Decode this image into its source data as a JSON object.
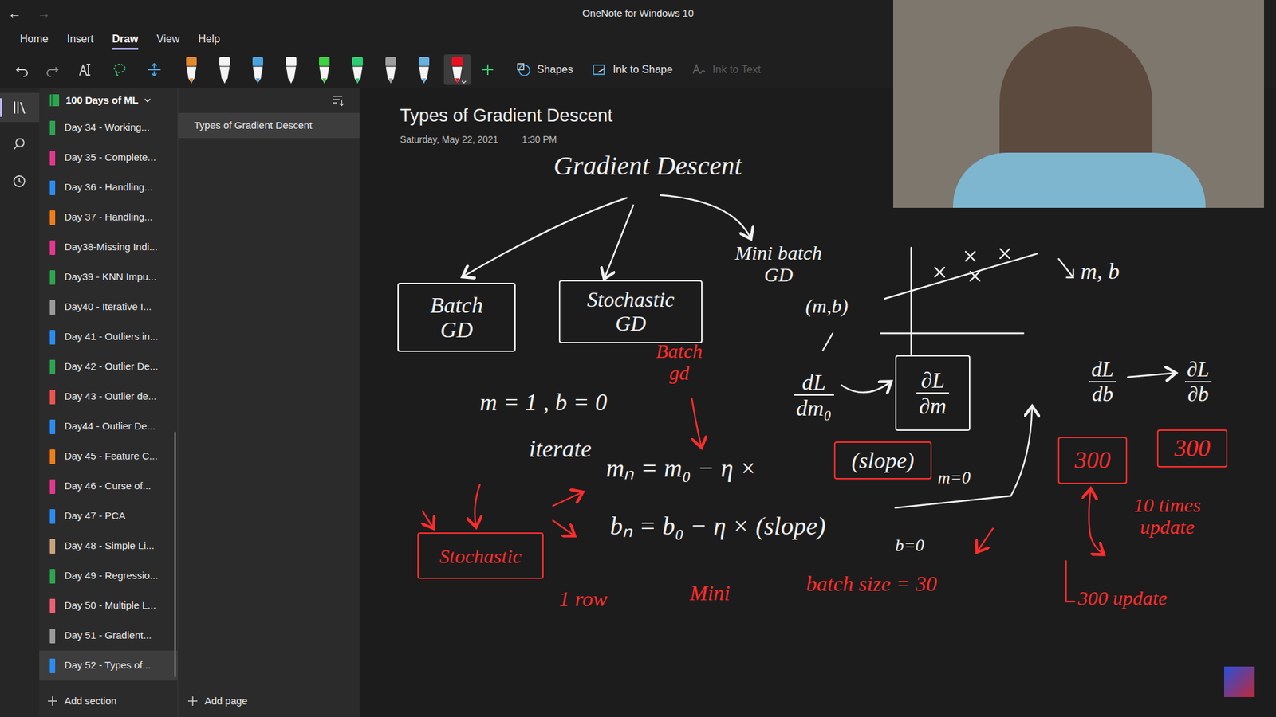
{
  "window": {
    "title": "OneNote for Windows 10"
  },
  "nav": [
    {
      "glyph": "←",
      "disabled": false
    },
    {
      "glyph": "→",
      "disabled": true
    }
  ],
  "menu_tabs": [
    {
      "label": "Home",
      "selected": false
    },
    {
      "label": "Insert",
      "selected": false
    },
    {
      "label": "Draw",
      "selected": true
    },
    {
      "label": "View",
      "selected": false
    },
    {
      "label": "Help",
      "selected": false
    }
  ],
  "toolbar": {
    "pens": [
      {
        "color": "#e08a2c",
        "selected": false
      },
      {
        "color": "#f4f4f4",
        "selected": false
      },
      {
        "color": "#4aa3df",
        "selected": false
      },
      {
        "color": "#f4f4f4",
        "selected": false
      },
      {
        "color": "#3fd13f",
        "selected": false
      },
      {
        "color": "#2ecc71",
        "selected": false
      },
      {
        "color": "#9e9e9e",
        "selected": false
      },
      {
        "color": "#6ab0de",
        "selected": false
      },
      {
        "color": "#e81123",
        "selected": true
      }
    ],
    "shapes": "Shapes",
    "ink_to_shape": "Ink to Shape",
    "ink_to_text": {
      "label": "Ink to Text",
      "disabled": true
    }
  },
  "rail": [
    {
      "selected": true
    },
    {
      "selected": false
    },
    {
      "selected": false
    }
  ],
  "notebook": {
    "name": "100 Days of ML"
  },
  "sections": [
    {
      "label": "Day 34 - Working...",
      "color": "#2ea44f",
      "selected": false
    },
    {
      "label": "Day 35 - Complete...",
      "color": "#e3368f",
      "selected": false
    },
    {
      "label": "Day 36 - Handling...",
      "color": "#2a8bf2",
      "selected": false
    },
    {
      "label": "Day 37 - Handling...",
      "color": "#f07c1a",
      "selected": false
    },
    {
      "label": "Day38-Missing Indi...",
      "color": "#e3368f",
      "selected": false
    },
    {
      "label": "Day39 - KNN Impu...",
      "color": "#2ea44f",
      "selected": false
    },
    {
      "label": "Day40 - Iterative I...",
      "color": "#9a9a9a",
      "selected": false
    },
    {
      "label": "Day 41 - Outliers in...",
      "color": "#2a8bf2",
      "selected": false
    },
    {
      "label": "Day 42 - Outlier De...",
      "color": "#2ea44f",
      "selected": false
    },
    {
      "label": "Day 43 - Outlier de...",
      "color": "#ef5350",
      "selected": false
    },
    {
      "label": "Day44 - Outlier De...",
      "color": "#2a8bf2",
      "selected": false
    },
    {
      "label": "Day 45 - Feature C...",
      "color": "#f07c1a",
      "selected": false
    },
    {
      "label": "Day 46 - Curse of...",
      "color": "#e3368f",
      "selected": false
    },
    {
      "label": "Day 47 - PCA",
      "color": "#2a8bf2",
      "selected": false
    },
    {
      "label": "Day 48 - Simple Li...",
      "color": "#c8a27a",
      "selected": false
    },
    {
      "label": "Day 49 - Regressio...",
      "color": "#2ea44f",
      "selected": false
    },
    {
      "label": "Day 50 - Multiple L...",
      "color": "#ef5f72",
      "selected": false
    },
    {
      "label": "Day 51 - Gradient...",
      "color": "#9a9a9a",
      "selected": false
    },
    {
      "label": "Day 52 - Types of...",
      "color": "#2a8bf2",
      "selected": true
    }
  ],
  "pages": [
    {
      "label": "Types of Gradient Descent",
      "selected": true
    }
  ],
  "add_section": "Add section",
  "add_page": "Add page",
  "page": {
    "title": "Types of Gradient Descent",
    "date": "Saturday, May 22, 2021",
    "time": "1:30 PM",
    "ink": [
      {
        "kind": "text",
        "lines": [
          "Gradient Descent"
        ],
        "color": "#f2f2f2",
        "boxed": false
      },
      {
        "kind": "text",
        "lines": [
          "Batch",
          "GD"
        ],
        "color": "#f2f2f2",
        "boxed": true,
        "box_color": "#f2f2f2"
      },
      {
        "kind": "text",
        "lines": [
          "Stochastic",
          "GD"
        ],
        "color": "#f2f2f2",
        "boxed": true,
        "box_color": "#f2f2f2"
      },
      {
        "kind": "text",
        "lines": [
          "Mini batch",
          "GD"
        ],
        "color": "#f2f2f2",
        "boxed": false
      },
      {
        "kind": "text",
        "lines": [
          "(m,b)"
        ],
        "color": "#f2f2f2",
        "boxed": false
      },
      {
        "kind": "text",
        "lines": [
          "m, b"
        ],
        "color": "#f2f2f2",
        "boxed": false
      },
      {
        "kind": "fraction",
        "lines": [
          "dL",
          "dm₀"
        ],
        "color": "#f2f2f2",
        "boxed": false
      },
      {
        "kind": "fraction",
        "lines": [
          "∂L",
          "∂m"
        ],
        "color": "#f2f2f2",
        "boxed": true,
        "box_color": "#f2f2f2"
      },
      {
        "kind": "fraction",
        "lines": [
          "dL",
          "db"
        ],
        "color": "#f2f2f2",
        "boxed": false
      },
      {
        "kind": "fraction",
        "lines": [
          "∂L",
          "∂b"
        ],
        "color": "#f2f2f2",
        "boxed": false
      },
      {
        "kind": "text",
        "lines": [
          "m = 1 , b = 0"
        ],
        "color": "#f2f2f2",
        "boxed": false
      },
      {
        "kind": "text",
        "lines": [
          "iterate"
        ],
        "color": "#f2f2f2",
        "boxed": false
      },
      {
        "kind": "text",
        "lines": [
          "mₙ = m₀ − η ×"
        ],
        "color": "#f2f2f2",
        "boxed": false
      },
      {
        "kind": "text",
        "lines": [
          "(slope)"
        ],
        "color": "#f2f2f2",
        "boxed": true,
        "box_color": "#ff2d2d"
      },
      {
        "kind": "text",
        "lines": [
          "m=0"
        ],
        "color": "#f2f2f2",
        "boxed": false
      },
      {
        "kind": "text",
        "lines": [
          "bₙ = b₀ − η × (slope)"
        ],
        "color": "#f2f2f2",
        "boxed": false
      },
      {
        "kind": "text",
        "lines": [
          "b=0"
        ],
        "color": "#f2f2f2",
        "boxed": false
      },
      {
        "kind": "text",
        "lines": [
          "Batch",
          "gd"
        ],
        "color": "#ff2d2d",
        "boxed": false
      },
      {
        "kind": "text",
        "lines": [
          "Stochastic"
        ],
        "color": "#ff2d2d",
        "boxed": true,
        "box_color": "#ff2d2d"
      },
      {
        "kind": "text",
        "lines": [
          "1 row"
        ],
        "color": "#ff2d2d",
        "boxed": false
      },
      {
        "kind": "text",
        "lines": [
          "Mini"
        ],
        "color": "#ff2d2d",
        "boxed": false
      },
      {
        "kind": "text",
        "lines": [
          "batch size = 30"
        ],
        "color": "#ff2d2d",
        "boxed": false
      },
      {
        "kind": "text",
        "lines": [
          "300"
        ],
        "color": "#ff2d2d",
        "boxed": true,
        "box_color": "#ff2d2d"
      },
      {
        "kind": "text",
        "lines": [
          "300"
        ],
        "color": "#ff2d2d",
        "boxed": true,
        "box_color": "#ff2d2d"
      },
      {
        "kind": "text",
        "lines": [
          "10 times",
          "update"
        ],
        "color": "#ff2d2d",
        "boxed": false
      },
      {
        "kind": "text",
        "lines": [
          "300 update"
        ],
        "color": "#ff2d2d",
        "boxed": false
      }
    ]
  }
}
